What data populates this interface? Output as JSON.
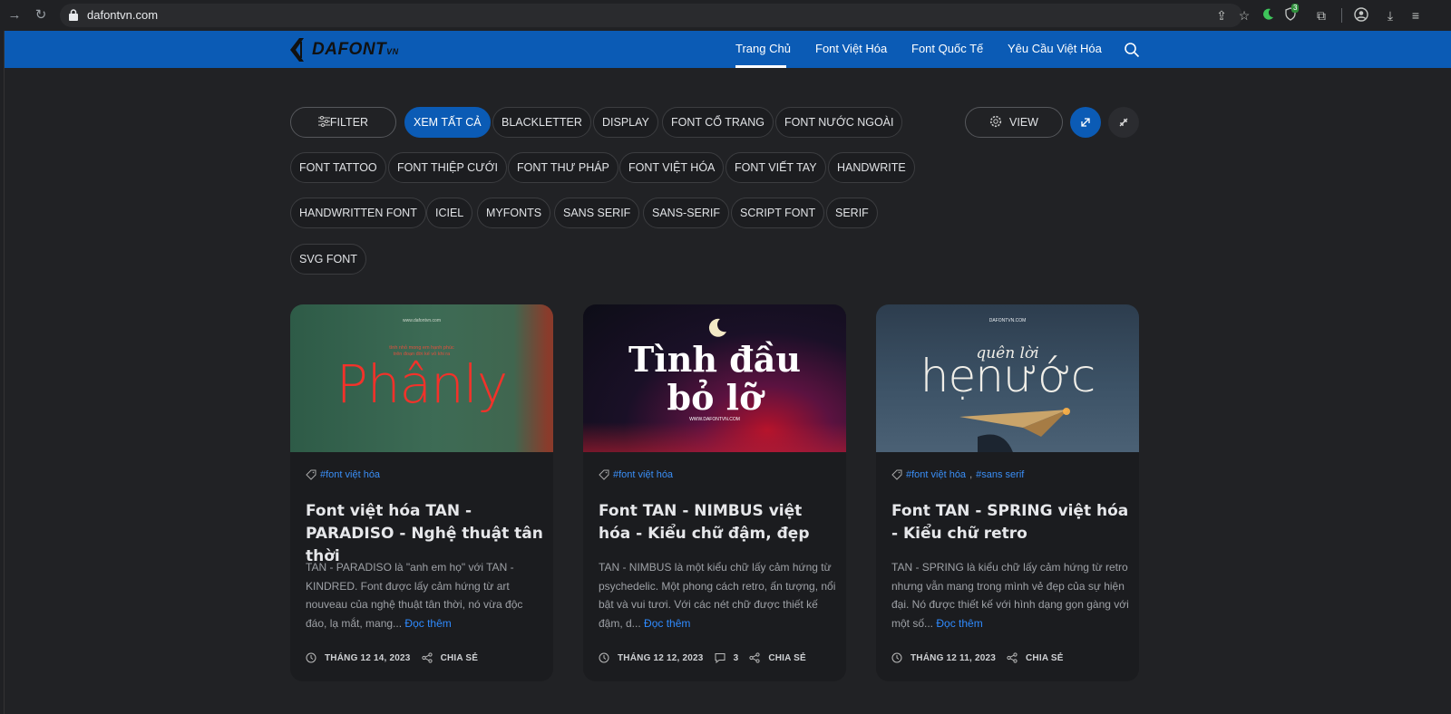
{
  "browser": {
    "url": "dafontvn.com",
    "extension_badge": "3"
  },
  "site": {
    "logo_text": "DAFONT",
    "logo_suffix": "VN",
    "menu": [
      {
        "label": "Trang Chủ",
        "active": true
      },
      {
        "label": "Font Việt Hóa"
      },
      {
        "label": "Font Quốc Tế"
      },
      {
        "label": "Yêu Cầu Việt Hóa"
      }
    ]
  },
  "filters": {
    "filter_label": "FILTER",
    "view_label": "VIEW",
    "tags": [
      "XEM TẤT CẢ",
      "BLACKLETTER",
      "DISPLAY",
      "FONT CỔ TRANG",
      "FONT NƯỚC NGOÀI",
      "FONT TATTOO",
      "FONT THIỆP CƯỚI",
      "FONT THƯ PHÁP",
      "FONT VIỆT HÓA",
      "FONT VIẾT TAY",
      "HANDWRITE",
      "HANDWRITTEN FONT",
      "ICIEL",
      "MYFONTS",
      "SANS SERIF",
      "SANS-SERIF",
      "SCRIPT FONT",
      "SERIF",
      "SVG FONT"
    ]
  },
  "cards": [
    {
      "thumb": {
        "site": "www.dafontvn.com",
        "small": "tình nhỏ mong em hạnh phúc",
        "small2": "trên đoạn đời kế vỏ khi ra",
        "big": "Phânly"
      },
      "tags": [
        "#font việt hóa"
      ],
      "title": "Font việt hóa TAN - PARADISO - Nghệ thuật tân thời",
      "excerpt": "TAN - PARADISO là \"anh em họ\" với TAN - KINDRED. Font được lấy cảm hứng từ art nouveau của nghệ thuật tân thời, nó vừa độc đáo, lạ mắt, mang...",
      "more": "Đọc thêm",
      "date": "THÁNG 12 14, 2023",
      "comments": "",
      "share": "CHIA SẺ"
    },
    {
      "thumb": {
        "big1": "Tình đầu",
        "big2": "bỏ lỡ",
        "site": "WWW.DAFONTVN.COM"
      },
      "tags": [
        "#font việt hóa"
      ],
      "title": "Font TAN - NIMBUS việt hóa - Kiểu chữ đậm, đẹp",
      "excerpt": "TAN - NIMBUS là một kiểu chữ lấy cảm hứng từ psychedelic. Một phong cách retro, ấn tượng, nổi bật và vui tươi. Với các nét chữ được thiết kế đậm, d...",
      "more": "Đọc thêm",
      "date": "THÁNG 12 12, 2023",
      "comments": "3",
      "share": "CHIA SẺ"
    },
    {
      "thumb": {
        "site": "DAFONTVN.COM",
        "script": "quên lời",
        "big": "hẹnước"
      },
      "tags": [
        "#font việt hóa",
        "#sans serif"
      ],
      "title": "Font TAN - SPRING việt hóa - Kiểu chữ retro",
      "excerpt": "TAN - SPRING là kiểu chữ lấy cảm hứng từ retro nhưng vẫn mang trong mình vẻ đẹp của sự hiện đại. Nó được thiết kế với hình dạng gọn gàng với một số...",
      "more": "Đọc thêm",
      "date": "THÁNG 12 11, 2023",
      "comments": "",
      "share": "CHIA SẺ"
    }
  ],
  "colors": {
    "accent": "#0b5bb5",
    "link": "#2f8bff",
    "bg": "#212225"
  }
}
